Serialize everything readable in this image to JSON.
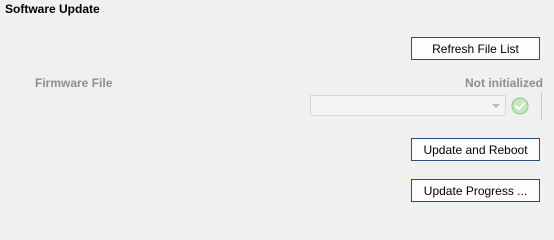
{
  "section": {
    "title": "Software Update"
  },
  "buttons": {
    "refresh_label": "Refresh File List",
    "update_label": "Update and Reboot",
    "progress_label": "Update Progress ..."
  },
  "firmware": {
    "label": "Firmware File",
    "status": "Not initialized",
    "selected_value": "",
    "status_icon": "check-circle-icon",
    "enabled": false
  },
  "colors": {
    "background": "#f0f0f0",
    "disabled_text": "#8e8e8e",
    "button_border": "#2a4f7a",
    "check_fill": "#c8e6c0",
    "check_stroke": "#8fc38a"
  }
}
